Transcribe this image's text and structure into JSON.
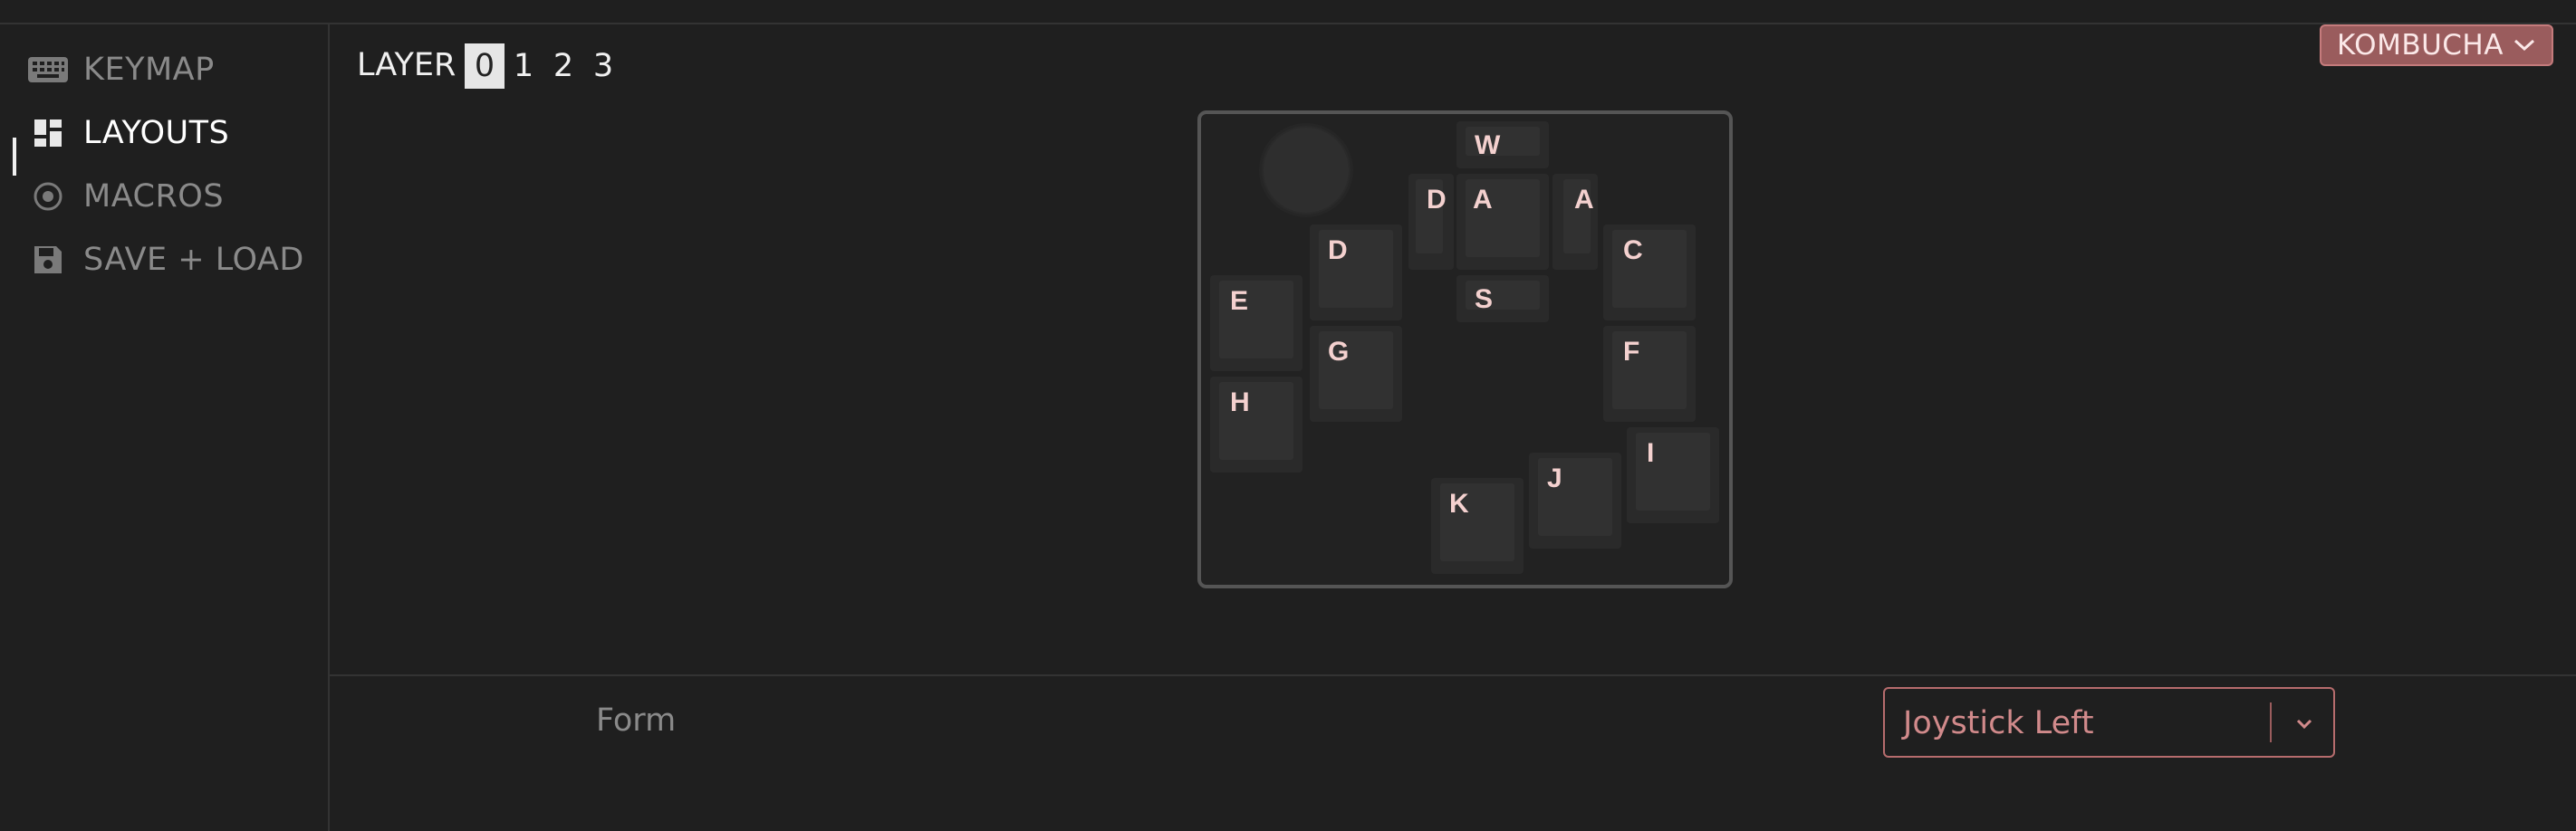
{
  "sidebar": {
    "items": [
      {
        "label": "KEYMAP",
        "icon": "keyboard-icon",
        "active": false
      },
      {
        "label": "LAYOUTS",
        "icon": "layouts-icon",
        "active": true
      },
      {
        "label": "MACROS",
        "icon": "record-icon",
        "active": false
      },
      {
        "label": "SAVE + LOAD",
        "icon": "floppy-disk-icon",
        "active": false
      }
    ]
  },
  "header": {
    "device": "KOMBUCHA",
    "layer_label": "LAYER",
    "layers": [
      "0",
      "1",
      "2",
      "3"
    ],
    "selected_layer": "0"
  },
  "keyboard": {
    "keys": [
      "W",
      "D",
      "A",
      "A",
      "D",
      "C",
      "S",
      "E",
      "G",
      "F",
      "H",
      "I",
      "J",
      "K"
    ]
  },
  "form": {
    "label": "Form",
    "value": "Joystick Left"
  },
  "colors": {
    "accent": "#9a5c5d",
    "accent_border": "#b66c6d",
    "key_label": "#f4d1cf",
    "background": "#1f1f1f"
  }
}
